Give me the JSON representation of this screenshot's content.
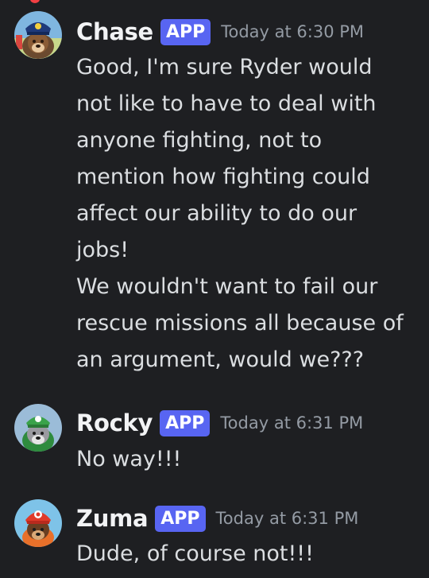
{
  "messages": [
    {
      "username": "Chase",
      "badge": "APP",
      "timestamp": "Today at 6:30 PM",
      "avatar_icon": "chase-avatar-icon",
      "paragraphs": [
        "Good, I'm sure Ryder would not like to have to deal with anyone fighting, not to mention how fighting could affect our ability to do our jobs!",
        "We wouldn't want to fail our rescue missions all because of an argument, would we???"
      ]
    },
    {
      "username": "Rocky",
      "badge": "APP",
      "timestamp": "Today at 6:31 PM",
      "avatar_icon": "rocky-avatar-icon",
      "paragraphs": [
        "No way!!!"
      ]
    },
    {
      "username": "Zuma",
      "badge": "APP",
      "timestamp": "Today at 6:31 PM",
      "avatar_icon": "zuma-avatar-icon",
      "paragraphs": [
        "Dude, of course not!!!"
      ]
    }
  ],
  "colors": {
    "background": "#1e1f22",
    "badge": "#5865f2",
    "text": "#dbdee1",
    "timestamp": "#949ba4"
  }
}
